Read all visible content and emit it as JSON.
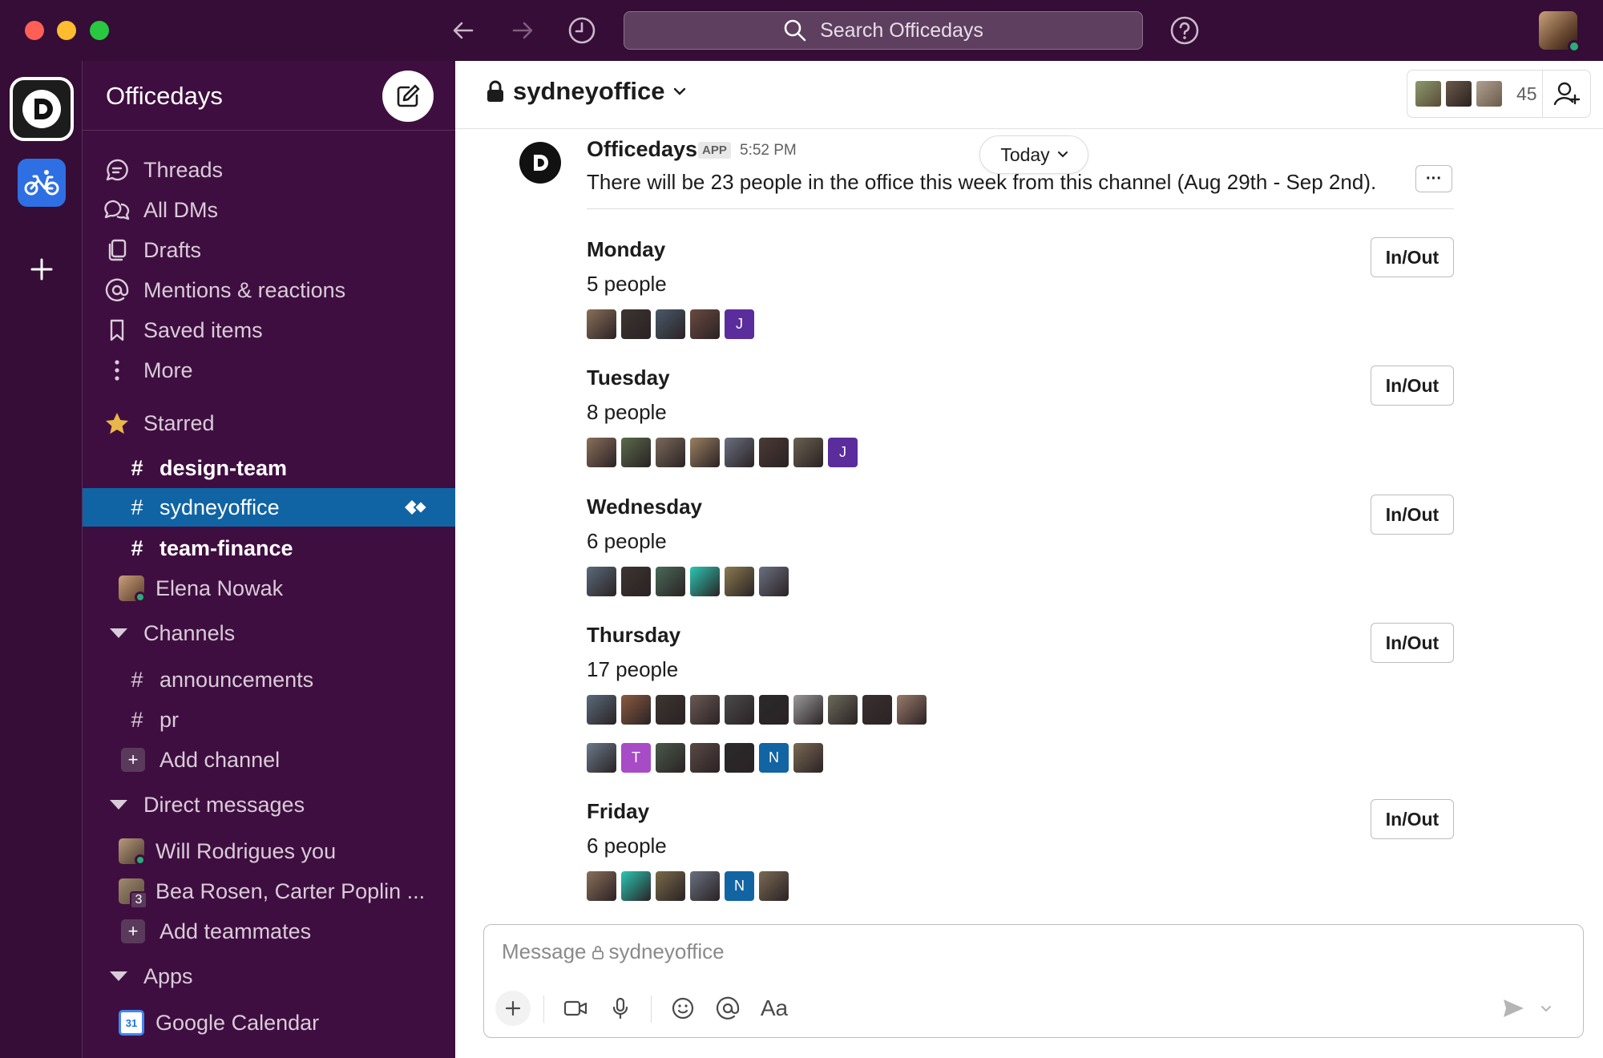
{
  "search": {
    "placeholder": "Search Officedays"
  },
  "sidebar": {
    "workspace_name": "Officedays",
    "nav": [
      {
        "label": "Threads"
      },
      {
        "label": "All DMs"
      },
      {
        "label": "Drafts"
      },
      {
        "label": "Mentions & reactions"
      },
      {
        "label": "Saved items"
      },
      {
        "label": "More"
      }
    ],
    "starred_label": "Starred",
    "starred": [
      {
        "label": "design-team"
      },
      {
        "label": "sydneyoffice"
      },
      {
        "label": "team-finance"
      },
      {
        "label": "Elena Nowak"
      }
    ],
    "channels_label": "Channels",
    "channels": [
      {
        "label": "announcements"
      },
      {
        "label": "pr"
      },
      {
        "label": "Add channel"
      }
    ],
    "dms_label": "Direct messages",
    "dms": [
      {
        "label": "Will Rodrigues  you"
      },
      {
        "label": "Bea Rosen, Carter Poplin ...",
        "badge": "3"
      },
      {
        "label": "Add teammates"
      }
    ],
    "apps_label": "Apps",
    "apps": [
      {
        "label": "Google Calendar",
        "icon_text": "31"
      }
    ]
  },
  "channel": {
    "name": "sydneyoffice",
    "member_count": "45"
  },
  "message": {
    "author": "Officedays",
    "badge": "APP",
    "time": "5:52 PM",
    "date_pill": "Today",
    "text": "There will be 23 people in the office this week from this channel (Aug 29th  - Sep 2nd).",
    "more_label": "···"
  },
  "days": [
    {
      "name": "Monday",
      "count": "5 people",
      "button": "In/Out",
      "avatars": [
        "#8a6f5a",
        "#3d3530",
        "#4a5a6a",
        "#6a4a40",
        {
          "letter": "J",
          "color": "#5B2C9C"
        }
      ]
    },
    {
      "name": "Tuesday",
      "count": "8 people",
      "button": "In/Out",
      "avatars": [
        "#8a6f5a",
        "#5a6a4a",
        "#7a6a5a",
        "#9a8060",
        "#6a7080",
        "#4a3a35",
        "#6a6050",
        {
          "letter": "J",
          "color": "#5B2C9C"
        }
      ]
    },
    {
      "name": "Wednesday",
      "count": "6 people",
      "button": "In/Out",
      "avatars": [
        "#5a6a7a",
        "#3d3530",
        "#4a6a5a",
        "#2BC7B4",
        "#8a7a50",
        "#6a7080"
      ]
    },
    {
      "name": "Thursday",
      "count": "17 people",
      "button": "In/Out",
      "avatars": [
        "#5a6a7a",
        "#8a5a40",
        "#3d3530",
        "#6a5a55",
        "#4a4a4a",
        "#2a2a2a",
        "#9a9a9a",
        "#6a6a5a",
        "#3a3030",
        "#9a7a6a"
      ],
      "avatars2": [
        "#6a7a8a",
        {
          "letter": "T",
          "color": "#A84BC7"
        },
        "#4a5a4a",
        "#5a4a45",
        "#2a2a2a",
        {
          "letter": "N",
          "color": "#1264A3"
        },
        "#7a6a55"
      ]
    },
    {
      "name": "Friday",
      "count": "6 people",
      "button": "In/Out",
      "avatars": [
        "#8a6f5a",
        "#2BC7B4",
        "#7a6a4a",
        "#6a7080",
        {
          "letter": "N",
          "color": "#1264A3"
        },
        "#7a6a55"
      ]
    }
  ],
  "composer": {
    "placeholder_prefix": "Message",
    "placeholder_channel": "sydneyoffice",
    "format_label": "Aa"
  }
}
